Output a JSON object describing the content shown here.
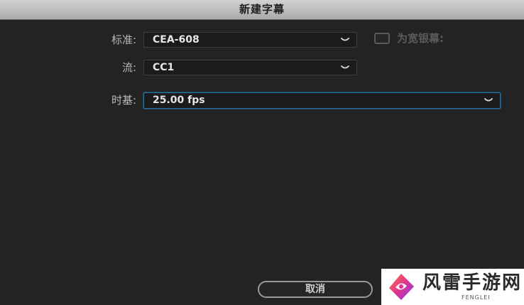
{
  "dialog": {
    "title": "新建字幕"
  },
  "form": {
    "standard": {
      "label": "标准:",
      "value": "CEA-608"
    },
    "stream": {
      "label": "流:",
      "value": "CC1"
    },
    "timebase": {
      "label": "时基:",
      "value": "25.00 fps"
    },
    "widescreen": {
      "label": "为宽银幕:",
      "checked": false
    }
  },
  "footer": {
    "cancel_label": "取消"
  },
  "watermark": {
    "brand": "风雷手游网",
    "sub": "FENGLEI"
  },
  "colors": {
    "background": "#232323",
    "titlebar": "#bdbdbd",
    "focus_border": "#2f6f9a"
  }
}
